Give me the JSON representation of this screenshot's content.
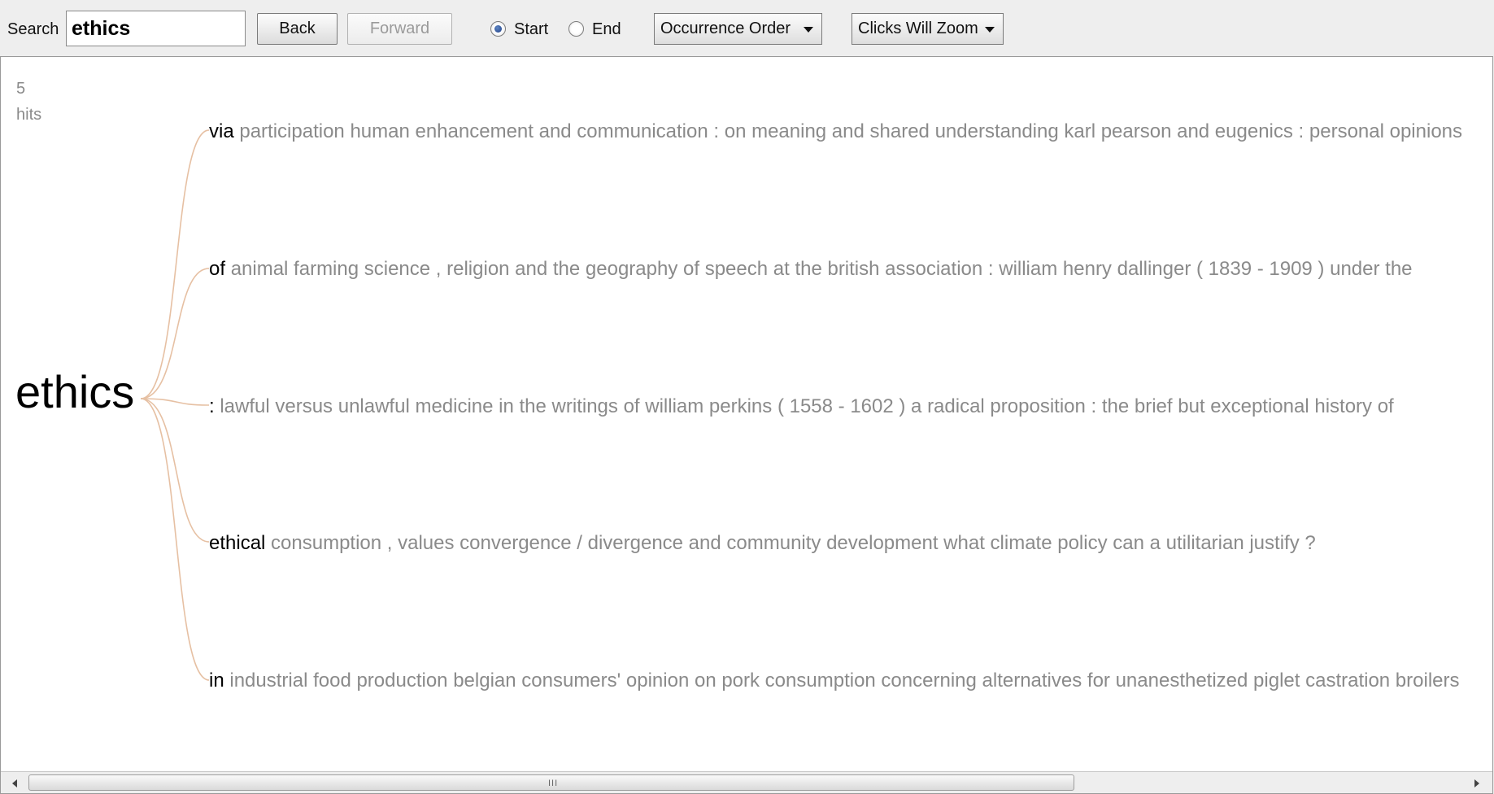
{
  "toolbar": {
    "search_label": "Search",
    "search_value": "ethics",
    "back_label": "Back",
    "forward_label": "Forward",
    "start_label": "Start",
    "end_label": "End",
    "selected_anchor": "Start",
    "order_label": "Occurrence Order",
    "click_label": "Clicks Will Zoom"
  },
  "results": {
    "hit_count": "5",
    "hit_word": "hits"
  },
  "tree": {
    "root": "ethics",
    "line_color": "#e6c0a3",
    "branches": [
      {
        "lead": "via",
        "rest": "participation human enhancement and communication : on meaning and shared understanding karl pearson and eugenics : personal opinions"
      },
      {
        "lead": "of",
        "rest": "animal farming science , religion and the geography of speech at the british association : william henry dallinger ( 1839 - 1909 ) under the"
      },
      {
        "lead": ":",
        "rest": "lawful versus unlawful medicine in the writings of william perkins ( 1558 - 1602 ) a radical proposition : the brief but exceptional history of"
      },
      {
        "lead": "ethical",
        "rest": "consumption , values convergence / divergence and community development what climate policy can a utilitarian justify ?"
      },
      {
        "lead": "in",
        "rest": "industrial food production belgian consumers' opinion on pork consumption concerning alternatives for unanesthetized piglet castration broilers"
      }
    ]
  },
  "scrollbar": {
    "grip": "III"
  }
}
